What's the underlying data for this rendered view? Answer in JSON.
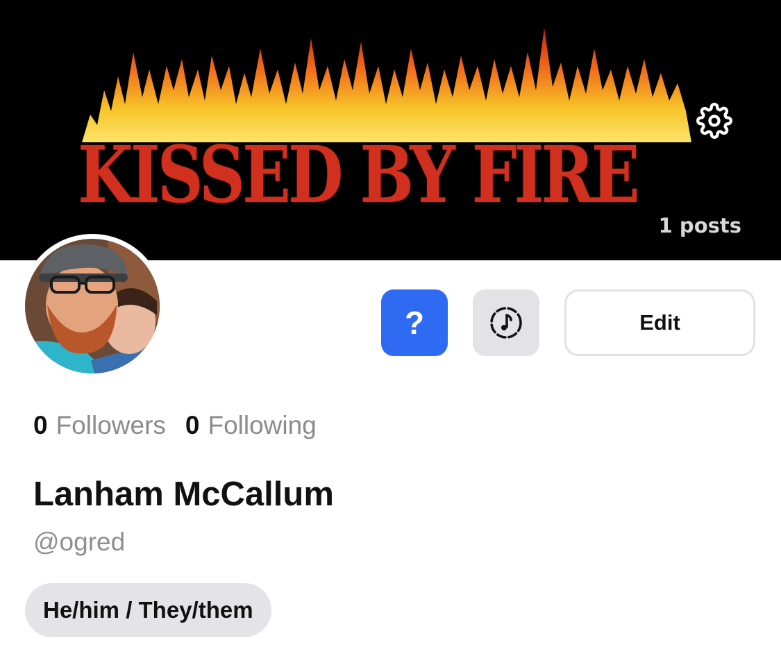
{
  "cover": {
    "banner_text": "KISSED BY FIRE",
    "posts_count": "1 posts",
    "settings_icon": "gear-icon"
  },
  "actions": {
    "help_icon": "question-mark-icon",
    "help_label": "?",
    "music_icon": "music-note-icon",
    "edit_label": "Edit",
    "help_color": "#2f6bf2",
    "music_bg": "#e3e3e7"
  },
  "stats": {
    "followers_count": "0",
    "followers_label": "Followers",
    "following_count": "0",
    "following_label": "Following"
  },
  "profile": {
    "display_name": "Lanham McCallum",
    "handle": "@ogred",
    "pronouns": "He/him / They/them"
  }
}
